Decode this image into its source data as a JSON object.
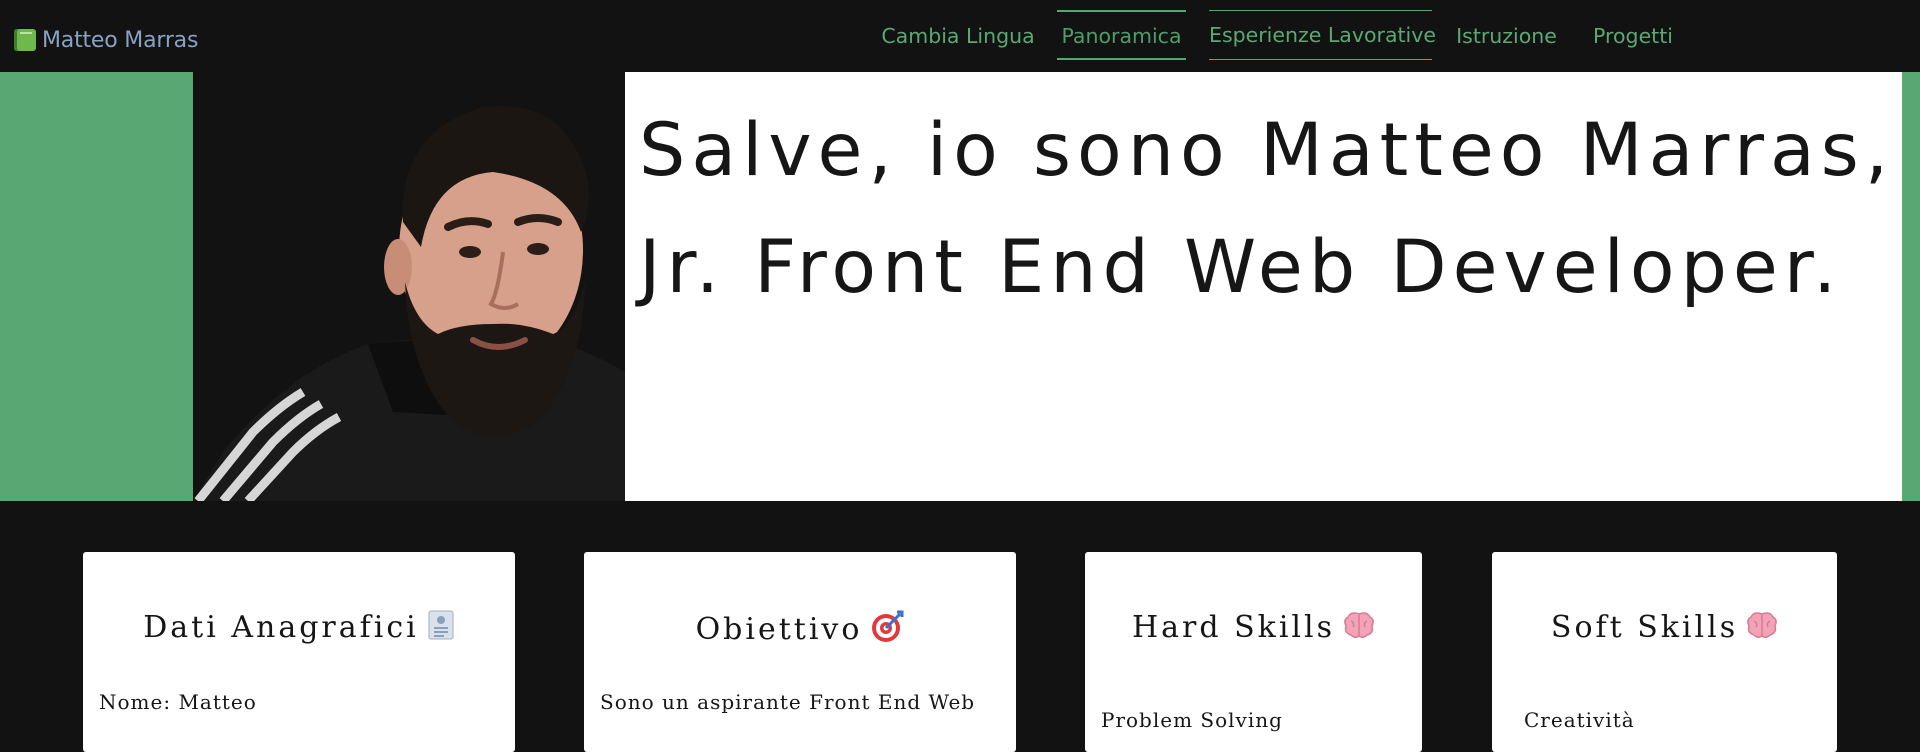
{
  "brand": {
    "name": "Matteo Marras",
    "icon": "green-book-icon"
  },
  "nav": {
    "items": [
      {
        "label": "Cambia Lingua"
      },
      {
        "label": "Panoramica",
        "active": true
      },
      {
        "label": "Esperienze Lavorative"
      },
      {
        "label": "Istruzione"
      },
      {
        "label": "Progetti"
      }
    ]
  },
  "hero": {
    "headline_line1": "Salve, io sono Matteo Marras,",
    "headline_line2": "Jr. Front End Web Developer.",
    "photo": "portrait-photo"
  },
  "cards": [
    {
      "title": "Dati Anagrafici",
      "emoji": "id-card-icon",
      "text": "Nome: Matteo"
    },
    {
      "title": "Obiettivo",
      "emoji": "target-icon",
      "text": "Sono un aspirante Front End Web"
    },
    {
      "title": "Hard Skills",
      "emoji": "brain-icon",
      "text": "Problem Solving"
    },
    {
      "title": "Soft Skills",
      "emoji": "brain-icon",
      "text": "Creatività"
    }
  ],
  "colors": {
    "background": "#121212",
    "accent_green": "#59a773",
    "nav_text": "#5aa874",
    "brand_text": "#8aa2c2",
    "panel": "#ffffff"
  }
}
